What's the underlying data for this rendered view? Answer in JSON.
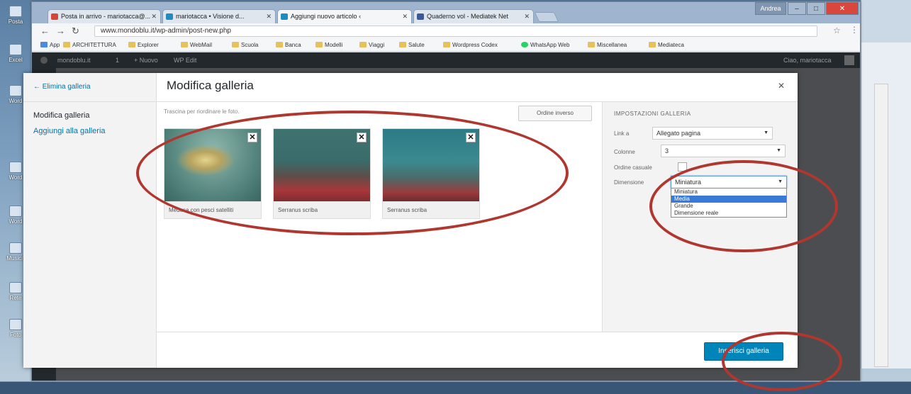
{
  "desktop": {
    "icons": [
      "Posta",
      "Excel",
      "Word",
      "Word",
      "Word",
      "Musica",
      "Rete",
      "Foto"
    ]
  },
  "browser": {
    "tabs": [
      {
        "label": "Posta in arrivo - mariotacca@...",
        "fav": "#d44638"
      },
      {
        "label": "mariotacca • Visione d...",
        "fav": "#1e8cbe"
      },
      {
        "label": "Aggiungi nuovo articolo ‹",
        "fav": "#1e8cbe"
      },
      {
        "label": "Quaderno vol - Mediatek Net",
        "fav": "#3b5998"
      }
    ],
    "window_user": "Andrea",
    "url": "www.mondoblu.it/wp-admin/post-new.php",
    "bookmarks": [
      "App",
      "ARCHITETTURA",
      "Explorer",
      "WebMail",
      "Scuola",
      "Banca",
      "Modelli",
      "Viaggi",
      "Salute",
      "Wordpress Codex",
      "WhatsApp Web",
      "Miscellanea",
      "Mediateca"
    ]
  },
  "adminbar": {
    "site": "mondoblu.it",
    "count": "1",
    "new": "+ Nuovo",
    "extra": "WP Edit",
    "greeting": "Ciao, mariotacca"
  },
  "modal": {
    "back_label": "← Elimina galleria",
    "menu_edit": "Modifica galleria",
    "menu_add": "Aggiungi alla galleria",
    "title": "Modifica galleria",
    "close_label": "✕",
    "drag_hint": "Trascina per riordinare le foto.",
    "reverse_label": "Ordine inverso",
    "attachments": [
      {
        "caption": "Medusa con pesci satelliti",
        "theme": "jelly"
      },
      {
        "caption": "Serranus scriba",
        "theme": "fish"
      },
      {
        "caption": "Serranus scriba",
        "theme": "fish2"
      }
    ],
    "remove_label": "✕",
    "settings": {
      "title": "IMPOSTAZIONI GALLERIA",
      "link_label": "Link a",
      "link_value": "Allegato pagina",
      "columns_label": "Colonne",
      "columns_value": "3",
      "random_label": "Ordine casuale",
      "size_label": "Dimensione",
      "size_value": "Miniatura",
      "size_options": [
        "Miniatura",
        "Media",
        "Grande",
        "Dimensione reale"
      ],
      "size_selected": 1
    },
    "insert_label": "Inserisci galleria"
  }
}
